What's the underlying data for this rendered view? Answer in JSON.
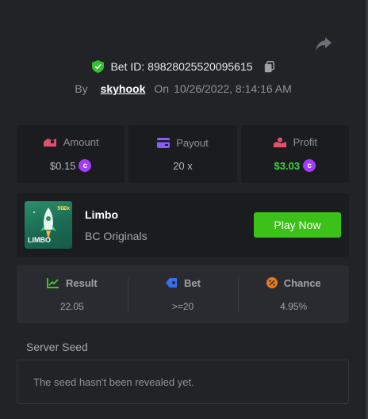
{
  "bet": {
    "label": "Bet ID: 89828025520095615",
    "by_label": "By",
    "user": "skyhook",
    "on_label": "On",
    "datetime": "10/26/2022, 8:14:16 AM"
  },
  "stats": [
    {
      "label": "Amount",
      "value": "$0.15",
      "icon": "amount-icon",
      "color": "#e2506b"
    },
    {
      "label": "Payout",
      "value": "20 x",
      "icon": "wallet-icon",
      "color": "#8a5cf6"
    },
    {
      "label": "Profit",
      "value": "$3.03",
      "icon": "profit-icon",
      "color": "#e2506b"
    }
  ],
  "game": {
    "name": "Limbo",
    "provider": "BC Originals",
    "thumb_label": "LIMBO",
    "thumb_badge": "500x",
    "play_label": "Play Now"
  },
  "results": [
    {
      "label": "Result",
      "value": "22.05",
      "icon": "chart-icon",
      "color": "#3fc12a"
    },
    {
      "label": "Bet",
      "value": ">=20",
      "icon": "tag-icon",
      "color": "#3a6df0"
    },
    {
      "label": "Chance",
      "value": "4.95%",
      "icon": "percent-icon",
      "color": "#e87b1e"
    }
  ],
  "seed": {
    "label": "Server Seed",
    "message": "The seed hasn't been revealed yet."
  },
  "colors": {
    "accent_green": "#3bc117",
    "coin": "#a43bff",
    "verified": "#2fc32b"
  }
}
